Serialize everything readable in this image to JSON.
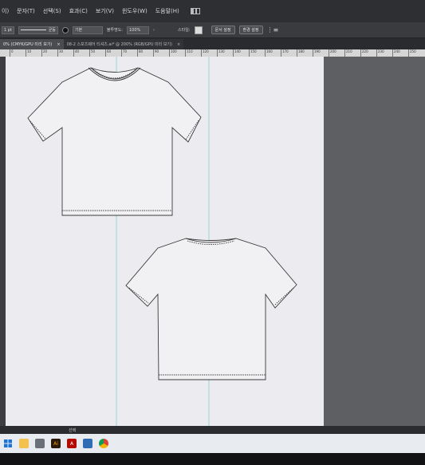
{
  "menu": {
    "items": [
      "이)",
      "문자(T)",
      "선택(S)",
      "효과(C)",
      "보기(V)",
      "윈도우(W)",
      "도움말(H)"
    ]
  },
  "control_bar": {
    "stroke_weight": "1 pt",
    "stroke_profile": "균등",
    "brush": "기본",
    "opacity_label": "불투명도:",
    "opacity_value": "100%",
    "style_label": "스타일:",
    "doc_setup_button": "문서 설정",
    "preferences_button": "환경 설정",
    "arrange_icon": "arrange-icon"
  },
  "tabs": [
    {
      "label": "0% (CMYK/GPU 미리 보기)",
      "active": true
    },
    {
      "label": "08-2 스포츠웨어 티셔츠.ai* @ 200% (RGB/GPU 미리 보기)",
      "active": false
    }
  ],
  "ruler": {
    "labels": [
      "0",
      "10",
      "20",
      "30",
      "40",
      "50",
      "60",
      "70",
      "80",
      "90",
      "100",
      "110",
      "120",
      "130",
      "140",
      "150",
      "160",
      "170",
      "180",
      "190",
      "200",
      "210",
      "220",
      "230",
      "240",
      "250"
    ]
  },
  "status": {
    "label": "선택"
  },
  "taskbar": {
    "icons": [
      "windows-logo-icon",
      "file-explorer-icon",
      "calculator-icon",
      "illustrator-icon",
      "acrobat-icon",
      "photos-icon",
      "chrome-icon"
    ]
  },
  "colors": {
    "menu_bg": "#2e2f33",
    "artboard": "#ececf0",
    "pasteboard": "#5e5f63",
    "guide": "#62c7c7"
  }
}
